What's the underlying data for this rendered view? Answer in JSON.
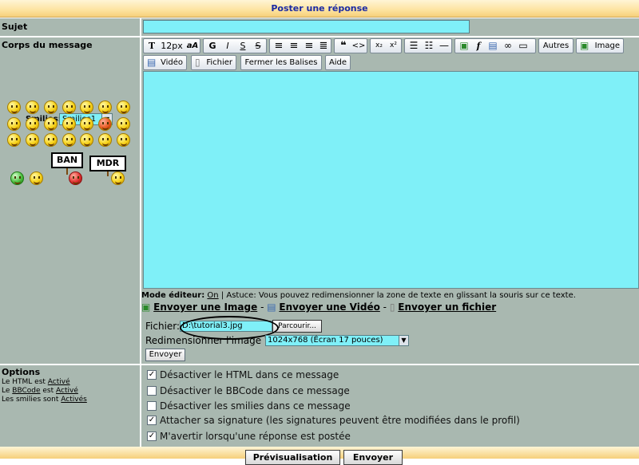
{
  "header": {
    "title": "Poster une réponse"
  },
  "subject": {
    "label": "Sujet",
    "value": ""
  },
  "body": {
    "label": "Corps du message",
    "value": ""
  },
  "smilies": {
    "label": "Smilies:",
    "selected": "Smilies1",
    "sign1": "BAN",
    "sign2": "MDR"
  },
  "toolbar": {
    "size": "12px",
    "aa": "aA",
    "bold": "G",
    "italic": "I",
    "underline": "S",
    "strike": "S",
    "quote": "❝",
    "code": "<>",
    "sub": "x₂",
    "sup": "x²",
    "others": "Autres",
    "image": "Image",
    "video": "Vidéo",
    "file": "Fichier",
    "close_tags": "Fermer les Balises",
    "help": "Aide"
  },
  "editor": {
    "mode_label": "Mode éditeur:",
    "mode_value": "On",
    "tip": "| Astuce: Vous pouvez redimensionner la zone de texte en glissant la souris sur ce texte."
  },
  "upload": {
    "send_image": "Envoyer une Image",
    "send_video": "Envoyer une Vidéo",
    "send_file": "Envoyer un fichier",
    "dash": "-",
    "file_label": "Fichier:",
    "file_value": "D:\\tutorial3.jpg",
    "browse": "Parcourir...",
    "resize_label": "Redimensionner l'image ?",
    "resize_value": "1024x768 (Écran 17 pouces)",
    "send_button": "Envoyer"
  },
  "options": {
    "title": "Options",
    "html_pre": "Le HTML est",
    "html_val": "Activé",
    "bb_pre": "Le",
    "bb_link": "BBCode",
    "bb_mid": "est",
    "bb_val": "Activé",
    "sm_pre": "Les smilies sont",
    "sm_val": "Activés",
    "items": [
      {
        "label": "Désactiver le HTML dans ce message",
        "checked": true
      },
      {
        "label": "Désactiver le BBCode dans ce message",
        "checked": false
      },
      {
        "label": "Désactiver les smilies dans ce message",
        "checked": false
      },
      {
        "label": "Attacher sa signature (les signatures peuvent être modifiées dans le profil)",
        "checked": true
      },
      {
        "label": "M'avertir lorsqu'une réponse est postée",
        "checked": true
      }
    ]
  },
  "footer": {
    "preview": "Prévisualisation",
    "send": "Envoyer"
  }
}
